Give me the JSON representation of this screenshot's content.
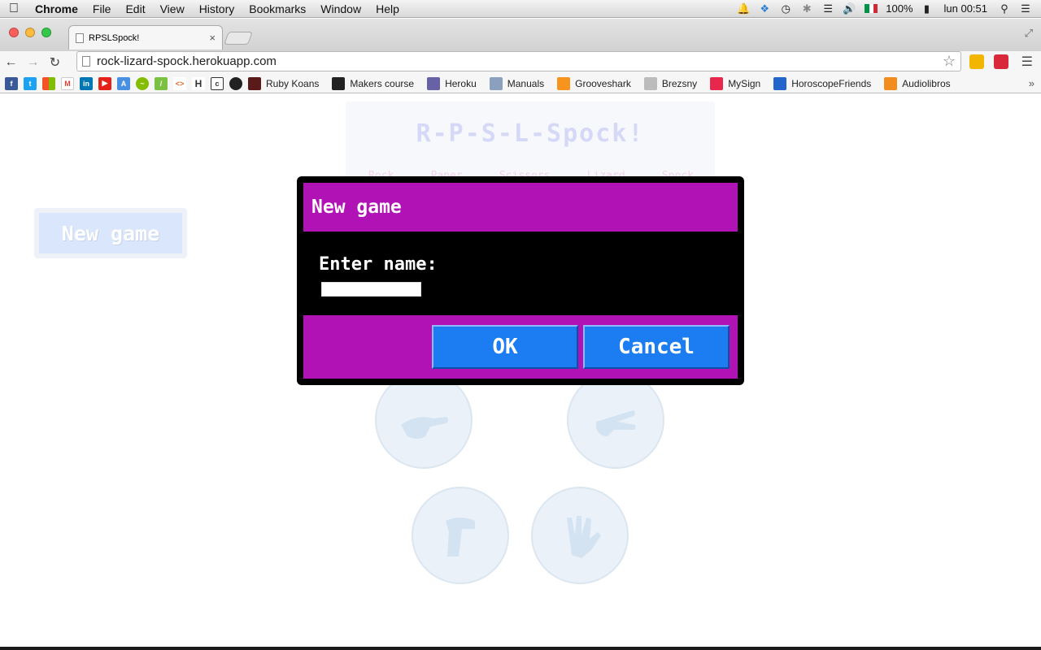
{
  "menubar": {
    "app_name": "Chrome",
    "items": [
      "File",
      "Edit",
      "View",
      "History",
      "Bookmarks",
      "Window",
      "Help"
    ],
    "battery": "100%",
    "clock": "lun 00:51"
  },
  "browser": {
    "tab_title": "RPSLSpock!",
    "url": "rock-lizard-spock.herokuapp.com",
    "bookmarks": [
      {
        "label": "Ruby Koans",
        "icon": "ruby-icon",
        "color": "#5a1a1a"
      },
      {
        "label": "Makers course",
        "icon": "github-icon",
        "color": "#222222"
      },
      {
        "label": "Heroku",
        "icon": "heroku-icon",
        "color": "#6762a6"
      },
      {
        "label": "Manuals",
        "icon": "folder-icon",
        "color": "#8aa0bd"
      },
      {
        "label": "Grooveshark",
        "icon": "grooveshark-icon",
        "color": "#f7941d"
      },
      {
        "label": "Brezsny",
        "icon": "page-icon",
        "color": "#bbbbbb"
      },
      {
        "label": "MySign",
        "icon": "mysign-icon",
        "color": "#e8274d"
      },
      {
        "label": "HoroscopeFriends",
        "icon": "moon-icon",
        "color": "#2266cc"
      },
      {
        "label": "Audiolibros",
        "icon": "info-icon",
        "color": "#f28c1e"
      }
    ]
  },
  "game": {
    "title": "R-P-S-L-Spock!",
    "moves": [
      "Rock",
      "Paper",
      "Scissors",
      "Lizard",
      "Spock"
    ],
    "new_game_label": "New game"
  },
  "dialog": {
    "title": "New game",
    "prompt": "Enter name:",
    "input_value": "",
    "ok_label": "OK",
    "cancel_label": "Cancel"
  },
  "colors": {
    "dialog_accent": "#b112b5",
    "button_blue": "#1c7cf2"
  }
}
